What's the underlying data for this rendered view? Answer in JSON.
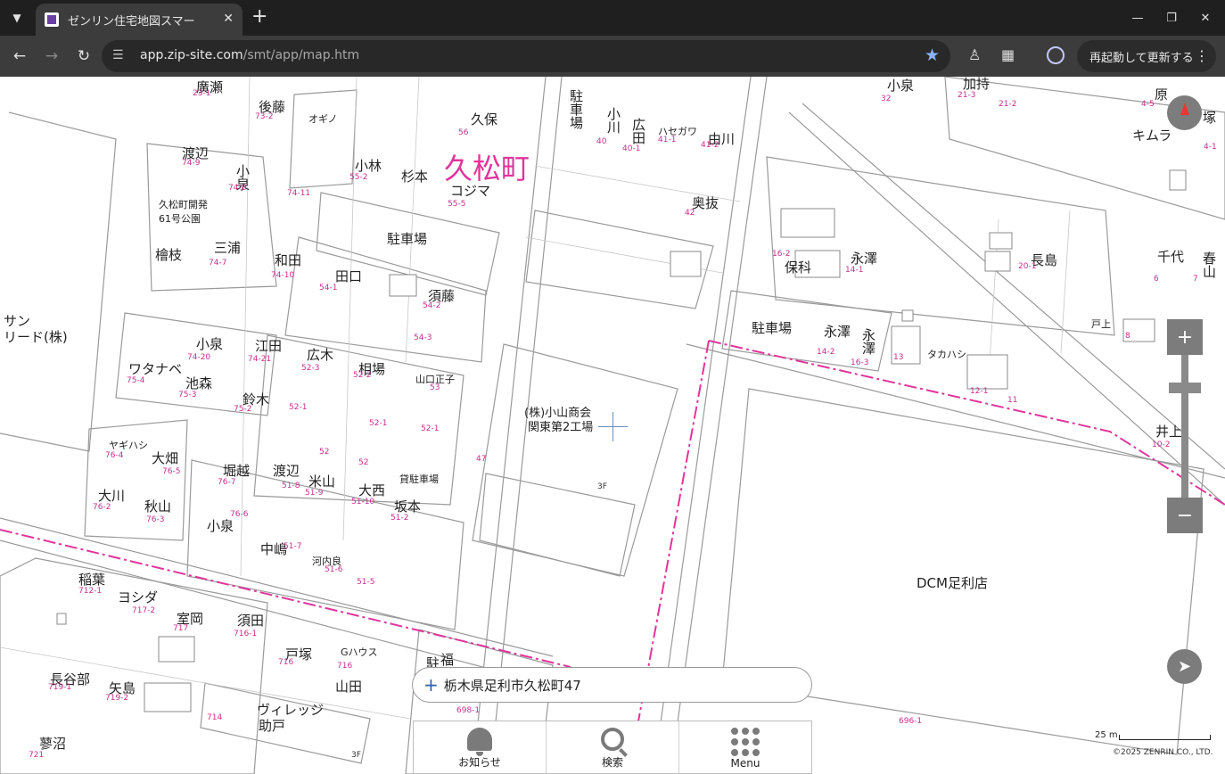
{
  "browser": {
    "tab_title": "ゼンリン住宅地図スマー",
    "url_host": "app.zip-site.com",
    "url_path": "/smt/app/map.htm",
    "relaunch_label": "再起動して更新する"
  },
  "map": {
    "town_name": "久松町",
    "labels": [
      {
        "text": "廣瀬"
      },
      {
        "text": "後藤"
      },
      {
        "text": "オギノ"
      },
      {
        "text": "久保"
      },
      {
        "text": "駐車場"
      },
      {
        "text": "小川"
      },
      {
        "text": "広田"
      },
      {
        "text": "ハセガワ"
      },
      {
        "text": "由川"
      },
      {
        "text": "小泉"
      },
      {
        "text": "加持"
      },
      {
        "text": "原"
      },
      {
        "text": "塚"
      },
      {
        "text": "キムラ"
      },
      {
        "text": "渡辺"
      },
      {
        "text": "小泉"
      },
      {
        "text": "小林"
      },
      {
        "text": "杉本"
      },
      {
        "text": "コジマ"
      },
      {
        "text": "久松町開発61号公園"
      },
      {
        "text": "駐車場"
      },
      {
        "text": "奥抜"
      },
      {
        "text": "永澤"
      },
      {
        "text": "長島"
      },
      {
        "text": "千代"
      },
      {
        "text": "春山"
      },
      {
        "text": "檜枝"
      },
      {
        "text": "三浦"
      },
      {
        "text": "和田"
      },
      {
        "text": "田口"
      },
      {
        "text": "須藤"
      },
      {
        "text": "保科"
      },
      {
        "text": "サン"
      },
      {
        "text": "リード(株)"
      },
      {
        "text": "小泉"
      },
      {
        "text": "江田"
      },
      {
        "text": "広木"
      },
      {
        "text": "相場"
      },
      {
        "text": "山口正子"
      },
      {
        "text": "駐車場"
      },
      {
        "text": "永澤"
      },
      {
        "text": "永澤"
      },
      {
        "text": "タカハシ"
      },
      {
        "text": "戸上"
      },
      {
        "text": "ワタナベ"
      },
      {
        "text": "池森"
      },
      {
        "text": "鈴木"
      },
      {
        "text": "(株)小山商会"
      },
      {
        "text": "関東第2工場"
      },
      {
        "text": "井上"
      },
      {
        "text": "ヤギハシ"
      },
      {
        "text": "大畑"
      },
      {
        "text": "堀越"
      },
      {
        "text": "渡辺"
      },
      {
        "text": "米山"
      },
      {
        "text": "大西"
      },
      {
        "text": "坂本"
      },
      {
        "text": "貸駐車場"
      },
      {
        "text": "大川"
      },
      {
        "text": "秋山"
      },
      {
        "text": "小泉"
      },
      {
        "text": "中嶋"
      },
      {
        "text": "河内良"
      },
      {
        "text": "DCM足利店"
      },
      {
        "text": "稲葉"
      },
      {
        "text": "ヨシダ"
      },
      {
        "text": "室岡"
      },
      {
        "text": "須田"
      },
      {
        "text": "戸塚"
      },
      {
        "text": "Gハウス"
      },
      {
        "text": "山田"
      },
      {
        "text": "長谷部"
      },
      {
        "text": "矢島"
      },
      {
        "text": "ヴィレッジ"
      },
      {
        "text": "助戸"
      },
      {
        "text": "蓼沼"
      },
      {
        "text": "駐"
      },
      {
        "text": "福"
      }
    ],
    "parcel_numbers": [
      "23-1",
      "73-2",
      "56",
      "40",
      "40-1",
      "41-1",
      "41-2",
      "32",
      "21-3",
      "21-2",
      "4-5",
      "4-1",
      "74-9",
      "74-8",
      "55-2",
      "55-5",
      "74-11",
      "42",
      "14-1",
      "20-1",
      "6",
      "7",
      "74-10",
      "54-1",
      "54-2",
      "54-3",
      "16-2",
      "74-7",
      "74-20",
      "74-21",
      "52-3",
      "52-2",
      "53",
      "14-2",
      "16-3",
      "13",
      "12-1",
      "11",
      "8",
      "75-4",
      "75-3",
      "75-2",
      "52-1",
      "52-1",
      "52-1",
      "10-2",
      "76-4",
      "76-5",
      "76-7",
      "51-8",
      "51-9",
      "51-10",
      "51-2",
      "47",
      "52",
      "52",
      "76-2",
      "76-3",
      "76-6",
      "51-7",
      "51-6",
      "51-5",
      "712-1",
      "717-2",
      "717",
      "716-1",
      "716",
      "716",
      "719-1",
      "719-2",
      "714",
      "721",
      "698-1",
      "696-1",
      "3F",
      "3F"
    ],
    "address": "栃木県足利市久松町47",
    "scale_label": "25 m",
    "copyright": "©2025 ZENRIN CO., LTD."
  },
  "bottom_nav": {
    "notice": "お知らせ",
    "search": "検索",
    "menu": "Menu"
  },
  "colors": {
    "boundary": "#e0359b",
    "parcel_number": "#c5308f",
    "controls": "#7c7c7c",
    "star": "#8ab4f8"
  },
  "icons": {
    "compass": "compass-icon",
    "zoom_in": "plus-icon",
    "zoom_out": "minus-icon",
    "locate": "navigation-arrow-icon",
    "notice": "bell-icon",
    "search": "magnifier-icon",
    "menu": "grid-dots-icon"
  }
}
